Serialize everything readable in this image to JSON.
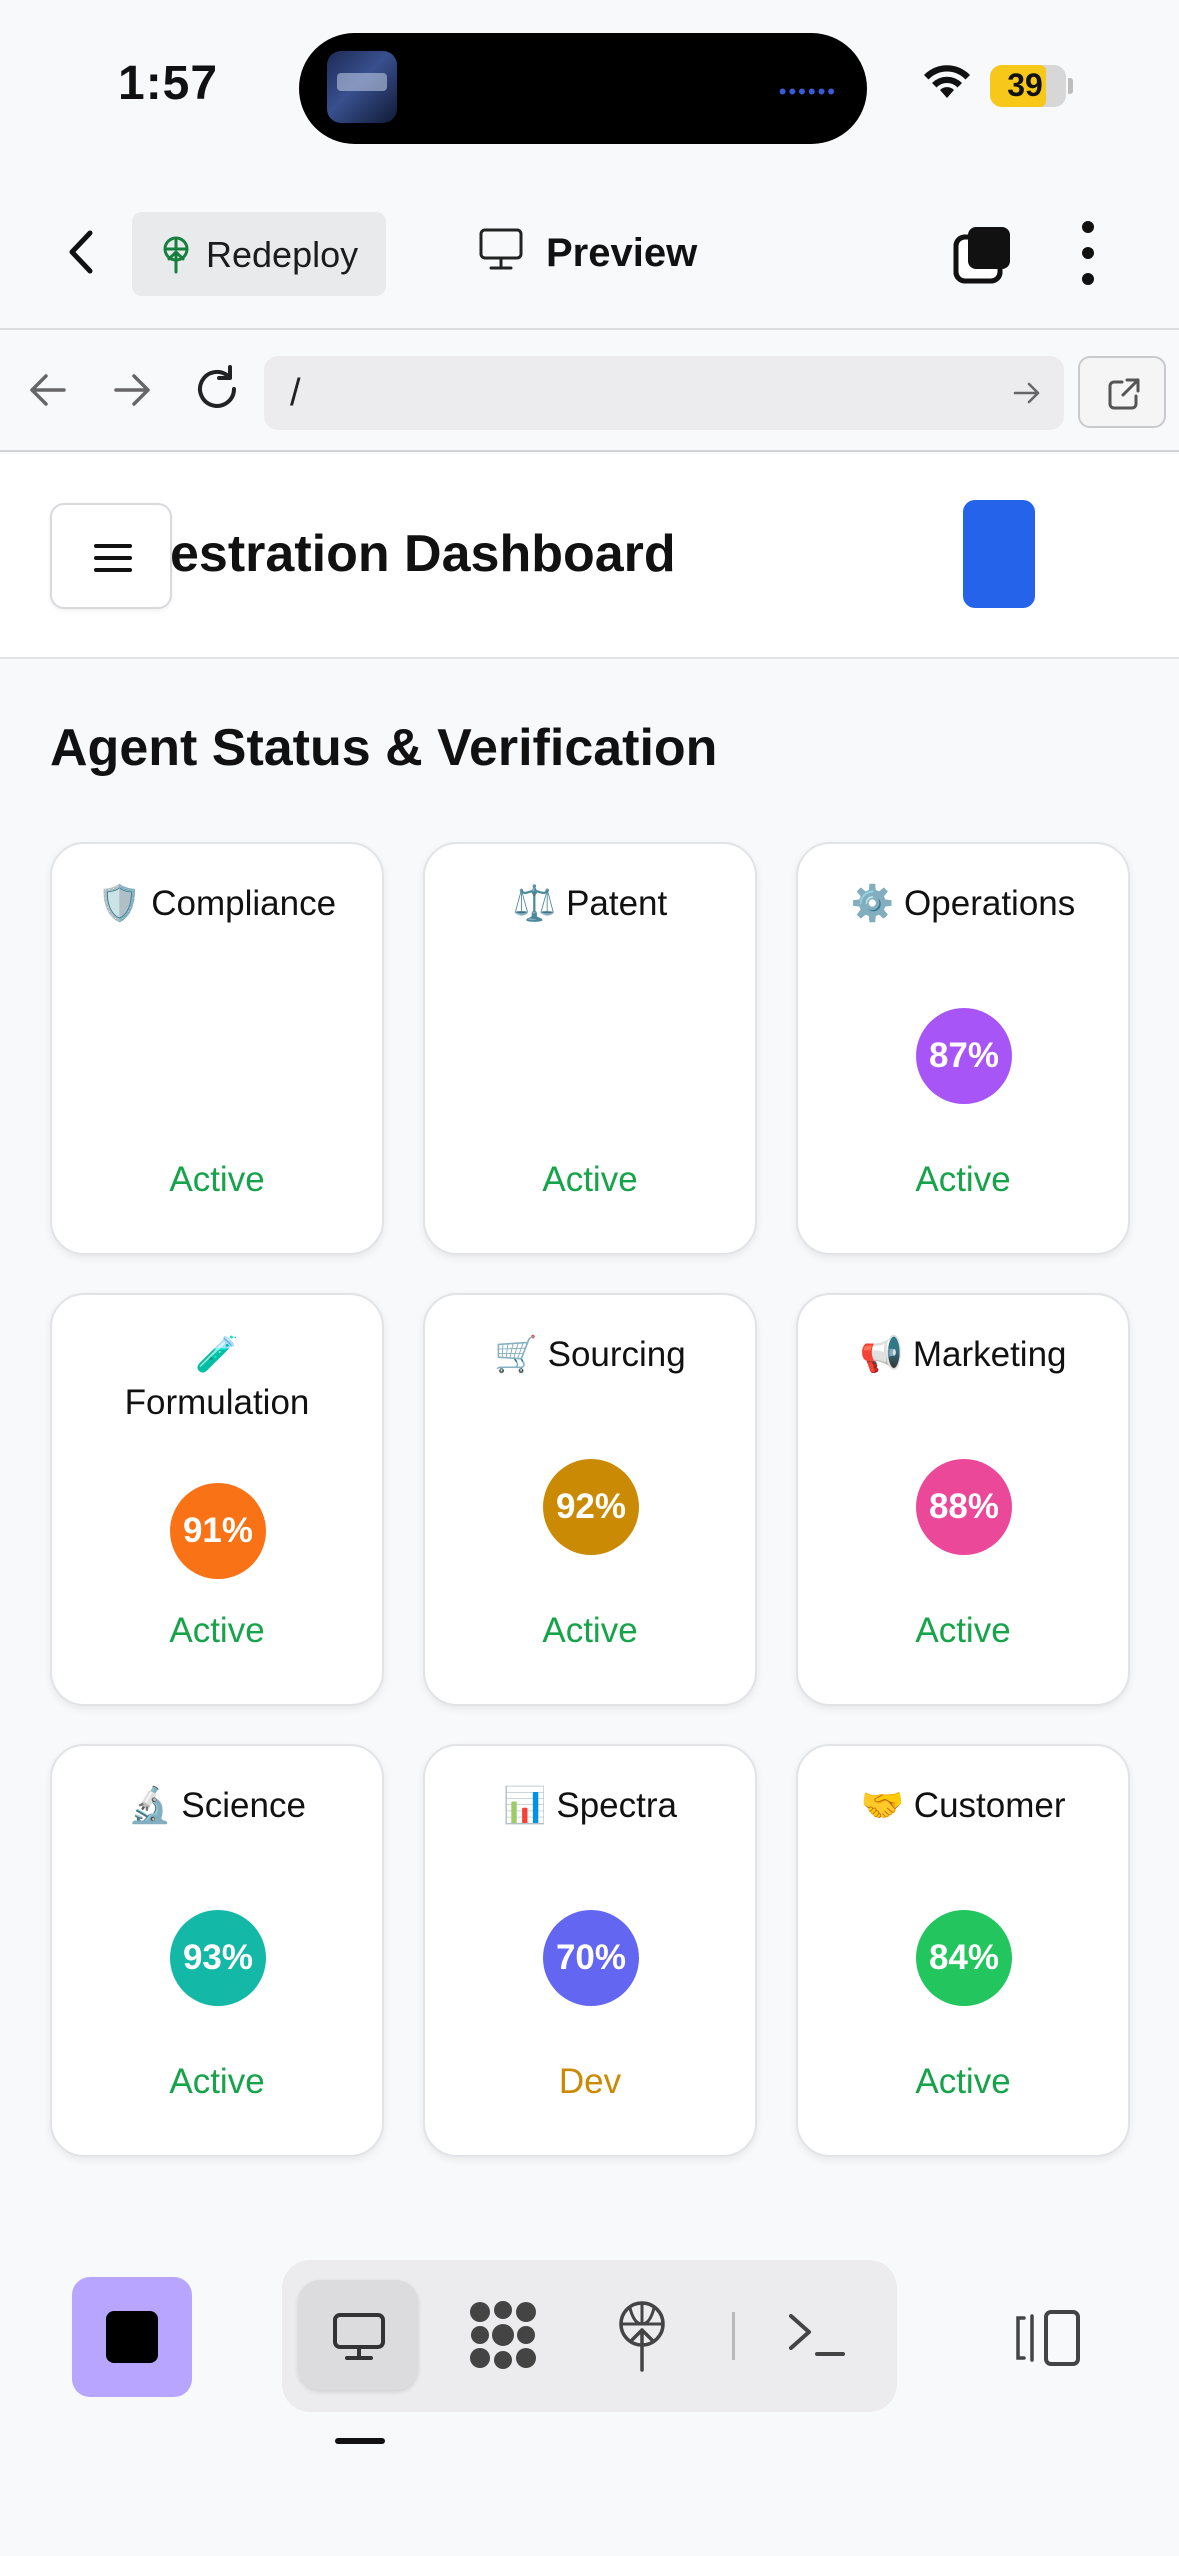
{
  "status_bar": {
    "time": "1:57",
    "battery": "39",
    "icons": [
      "wifi-icon",
      "battery-icon"
    ]
  },
  "app_header": {
    "redeploy_label": "Redeploy",
    "preview_label": "Preview",
    "icons": [
      "back-chevron-icon",
      "redeploy-icon",
      "monitor-icon",
      "tabs-icon",
      "more-vertical-icon"
    ]
  },
  "url_bar": {
    "url": "/",
    "icons": [
      "back-arrow-icon",
      "forward-arrow-icon",
      "reload-icon",
      "go-arrow-icon",
      "external-link-icon"
    ]
  },
  "dashboard": {
    "title": "estration Dashboard",
    "section_title": "Agent Status & Verification"
  },
  "agents": [
    {
      "icon": "🛡️",
      "name": "Compliance",
      "percent": "",
      "status": "Active",
      "color": ""
    },
    {
      "icon": "⚖️",
      "name": "Patent",
      "percent": "",
      "status": "Active",
      "color": ""
    },
    {
      "icon": "⚙️",
      "name": "Operations",
      "percent": "87%",
      "status": "Active",
      "color": "#a855f7"
    },
    {
      "icon": "🧪",
      "name": "Formulation",
      "percent": "91%",
      "status": "Active",
      "color": "#f97316"
    },
    {
      "icon": "🛒",
      "name": "Sourcing",
      "percent": "92%",
      "status": "Active",
      "color": "#ca8a04"
    },
    {
      "icon": "📢",
      "name": "Marketing",
      "percent": "88%",
      "status": "Active",
      "color": "#ec4899"
    },
    {
      "icon": "🔬",
      "name": "Science",
      "percent": "93%",
      "status": "Active",
      "color": "#14b8a6"
    },
    {
      "icon": "📊",
      "name": "Spectra",
      "percent": "70%",
      "status": "Dev",
      "color": "#6366f1"
    },
    {
      "icon": "🤝",
      "name": "Customer",
      "percent": "84%",
      "status": "Active",
      "color": "#22c55e"
    }
  ],
  "colors": {
    "active_status": "#16a34a",
    "dev_status": "#ca8a04",
    "accent_blue": "#2563eb",
    "stop_button": "#b7a5ff"
  },
  "bottom_toolbar": {
    "icons": [
      "stop-icon",
      "monitor-icon",
      "apps-icon",
      "deploy-icon",
      "terminal-icon",
      "side-panel-icon"
    ]
  }
}
